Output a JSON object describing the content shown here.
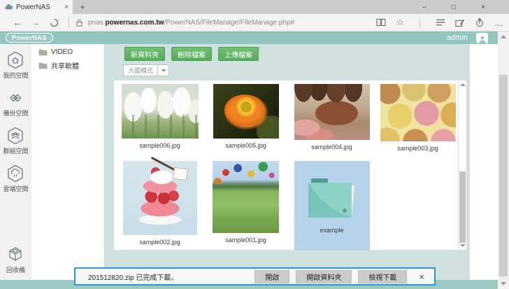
{
  "browser": {
    "tab": {
      "title": "PowerNAS"
    },
    "address": {
      "prefix": "pnas.",
      "domain": "powernas.com.tw",
      "path": "/PowerNAS/FileManage/FileManage.php#"
    }
  },
  "icons": {
    "back": "←",
    "forward": "→",
    "star": "☆",
    "more": "…",
    "minimize": "–",
    "maximize": "□",
    "close": "×",
    "new_tab": "+",
    "tab_close": "×",
    "download_close": "×"
  },
  "header": {
    "logo": "PowerNAS",
    "username": "admin"
  },
  "sidebar": {
    "items": [
      {
        "label": "我的空間",
        "icon": "home-hexagon-icon"
      },
      {
        "label": "備份空間",
        "icon": "backup-hexagon-icon"
      },
      {
        "label": "群組空間",
        "icon": "group-hexagon-icon"
      },
      {
        "label": "雲端空間",
        "icon": "cloud-hexagon-icon"
      }
    ],
    "recycle_label": "回收桶"
  },
  "tree": {
    "items": [
      {
        "label": "VIDEO"
      },
      {
        "label": "共享軟體"
      }
    ]
  },
  "actions": {
    "new_folder": "新資料夾",
    "delete_file": "刪除檔案",
    "upload_file": "上傳檔案",
    "view_mode": "大圖模式"
  },
  "files": {
    "items": [
      {
        "name": "sample006.jpg",
        "type": "image"
      },
      {
        "name": "sample005.jpg",
        "type": "image"
      },
      {
        "name": "sample004.jpg",
        "type": "image"
      },
      {
        "name": "sample003.jpg",
        "type": "image"
      },
      {
        "name": "sample002.jpg",
        "type": "image"
      },
      {
        "name": "sample001.jpg",
        "type": "image"
      },
      {
        "name": "example",
        "type": "folder"
      }
    ]
  },
  "download_bar": {
    "filename": "201512820.zip",
    "status": "已完成下載。",
    "open": "開啟",
    "open_folder": "開啟資料夾",
    "view_downloads": "檢視下載"
  },
  "colors": {
    "header_teal": "#92c5c0",
    "content_bg": "#cfe0df",
    "button_green": "#5cb761",
    "download_border": "#3095d6",
    "folder_tile": "#b5d4ec",
    "folder_icon": "#8ed1c6"
  }
}
